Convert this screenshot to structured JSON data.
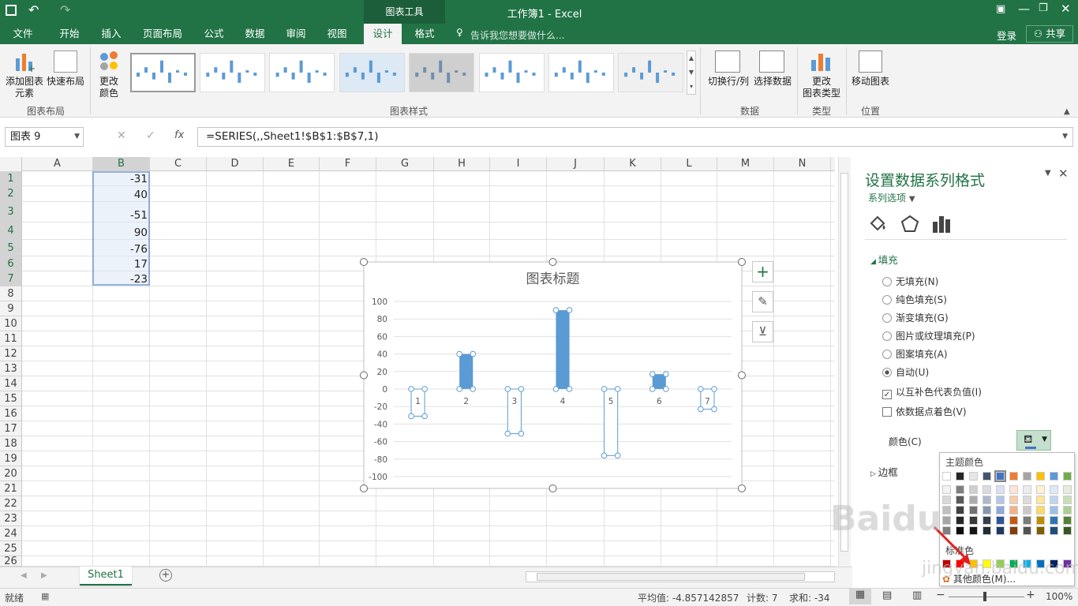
{
  "window": {
    "title": "工作簿1 - Excel",
    "context_tools": "图表工具",
    "signin": "登录",
    "share": "共享"
  },
  "tabs": [
    "文件",
    "开始",
    "插入",
    "页面布局",
    "公式",
    "数据",
    "审阅",
    "视图",
    "设计",
    "格式"
  ],
  "tell_me": "告诉我您想要做什么...",
  "ribbon": {
    "add_element": "添加图表",
    "add_element2": "元素",
    "quick_layout": "快速布局",
    "change_colors": "更改",
    "change_colors2": "颜色",
    "switch": "切换行/列",
    "select_data": "选择数据",
    "change_type": "更改",
    "change_type2": "图表类型",
    "move_chart": "移动图表",
    "groups": {
      "layout": "图表布局",
      "styles": "图表样式",
      "data": "数据",
      "type": "类型",
      "location": "位置"
    }
  },
  "formula": {
    "name_box": "图表 9",
    "fx": "fx",
    "value": "=SERIES(,,Sheet1!$B$1:$B$7,1)"
  },
  "columns": [
    "A",
    "B",
    "C",
    "D",
    "E",
    "F",
    "G",
    "H",
    "I",
    "J",
    "K",
    "L",
    "M",
    "N"
  ],
  "rows": [
    "1",
    "2",
    "3",
    "4",
    "5",
    "6",
    "7",
    "8",
    "9",
    "10",
    "11",
    "12",
    "13",
    "14",
    "15",
    "16",
    "17",
    "18",
    "19",
    "20",
    "21",
    "22",
    "23",
    "24",
    "25",
    "26"
  ],
  "cells_b": [
    "-31",
    "40",
    "-51",
    "90",
    "-76",
    "17",
    "-23"
  ],
  "chart_data": {
    "type": "bar",
    "title": "图表标题",
    "categories": [
      "1",
      "2",
      "3",
      "4",
      "5",
      "6",
      "7"
    ],
    "values": [
      -31,
      40,
      -51,
      90,
      -76,
      17,
      -23
    ],
    "ylim": [
      -100,
      100
    ],
    "yticks": [
      "100",
      "80",
      "60",
      "40",
      "20",
      "0",
      "-20",
      "-40",
      "-60",
      "-80",
      "-100"
    ],
    "grid": true,
    "bar_color": "#5b9bd5"
  },
  "pane": {
    "title": "设置数据系列格式",
    "series_options": "系列选项",
    "fill": "填充",
    "options": [
      "无填充(N)",
      "纯色填充(S)",
      "渐变填充(G)",
      "图片或纹理填充(P)",
      "图案填充(A)",
      "自动(U)"
    ],
    "invert": "以互补色代表负值(I)",
    "vary": "依数据点着色(V)",
    "color": "颜色(C)",
    "border": "边框"
  },
  "palette": {
    "theme": "主题颜色",
    "standard": "标准色",
    "more": "其他颜色(M)..."
  },
  "sheet": {
    "tab": "Sheet1"
  },
  "status": {
    "ready": "就绪",
    "avg": "平均值: -4.857142857",
    "count": "计数: 7",
    "sum": "求和: -34",
    "zoom": "100%"
  },
  "watermark": "Baidu 经验 jingyan.baidu.com"
}
